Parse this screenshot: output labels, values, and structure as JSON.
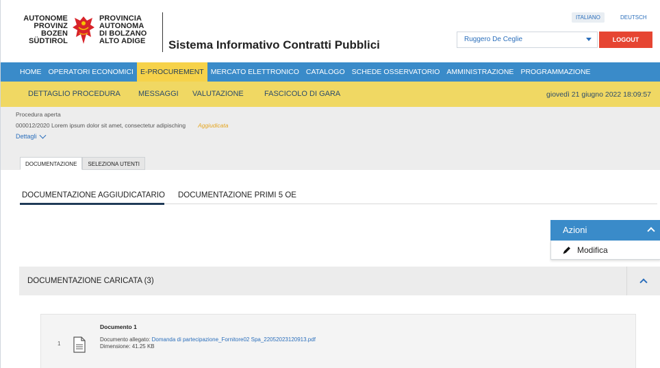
{
  "header": {
    "logo_left": [
      "AUTONOME",
      "PROVINZ",
      "BOZEN",
      "SÜDTIROL"
    ],
    "logo_right": [
      "PROVINCIA",
      "AUTONOMA",
      "DI BOLZANO",
      "ALTO ADIGE"
    ],
    "system_title": "Sistema Informativo Contratti Pubblici",
    "lang_it": "ITALIANO",
    "lang_de": "DEUTSCH",
    "user_name": "Ruggero De Ceglie",
    "logout_label": "LOGOUT"
  },
  "main_nav": [
    {
      "label": "HOME",
      "active": false
    },
    {
      "label": "OPERATORI ECONOMICI",
      "active": false
    },
    {
      "label": "E-PROCUREMENT",
      "active": true
    },
    {
      "label": "MERCATO ELETTRONICO",
      "active": false
    },
    {
      "label": "CATALOGO",
      "active": false
    },
    {
      "label": "SCHEDE OSSERVATORIO",
      "active": false
    },
    {
      "label": "AMMINISTRAZIONE",
      "active": false
    },
    {
      "label": "PROGRAMMAZIONE",
      "active": false
    }
  ],
  "sub_nav": {
    "items": [
      "DETTAGLIO PROCEDURA",
      "MESSAGGI",
      "VALUTAZIONE",
      "FASCICOLO DI GARA"
    ],
    "date": "giovedì 21 giugno 2022 18:09:57"
  },
  "procedure": {
    "type": "Procedura aperta",
    "description": "000012/2020 Lorem ipsum dolor sit amet, consectetur adipisching",
    "status": "Aggiudicata",
    "details_label": "Dettagli",
    "tabs": [
      {
        "label": "DOCUMENTAZIONE",
        "active": true
      },
      {
        "label": "SELEZIONA UTENTI",
        "active": false
      }
    ]
  },
  "doc_tabs": [
    {
      "label": "DOCUMENTAZIONE AGGIUDICATARIO",
      "active": true
    },
    {
      "label": "DOCUMENTAZIONE PRIMI 5 OE",
      "active": false
    }
  ],
  "actions": {
    "label": "Azioni",
    "items": [
      {
        "label": "Modifica",
        "icon": "pencil-icon"
      }
    ]
  },
  "section": {
    "title": "DOCUMENTAZIONE CARICATA (3)"
  },
  "documents": [
    {
      "index": "1",
      "title": "Documento 1",
      "attached_label": "Documento allegato:",
      "attached_file": "Domanda di partecipazione_Fornitore02 Spa_22052023120913.pdf",
      "size_label": "Dimensione:",
      "size": "41.25 KB"
    }
  ],
  "colors": {
    "nav_blue": "#3a8bc9",
    "nav_yellow": "#f0d863",
    "logout_red": "#e64532",
    "link_blue": "#2a6ebb",
    "status_orange": "#e4a520"
  }
}
